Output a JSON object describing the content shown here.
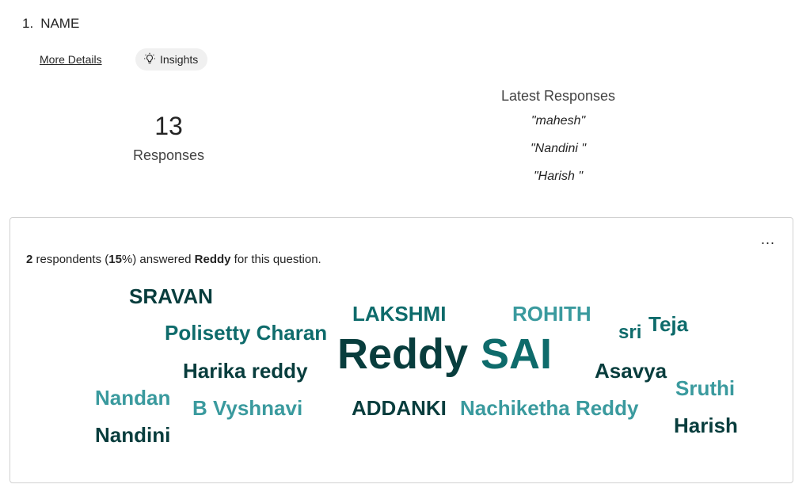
{
  "question": {
    "number": "1.",
    "title": "NAME"
  },
  "actions": {
    "more_details": "More Details",
    "insights": "Insights"
  },
  "stats": {
    "count": "13",
    "count_label": "Responses"
  },
  "latest": {
    "title": "Latest Responses",
    "items": [
      "\"mahesh\"",
      "\"Nandini \"",
      "\"Harish \""
    ]
  },
  "summary": {
    "count": "2",
    "text1": " respondents (",
    "percent": "15",
    "text2": "%) answered ",
    "answer": "Reddy",
    "text3": " for this question."
  },
  "menu": {
    "more_label": "..."
  },
  "colors": {
    "dark": "#083d3d",
    "mid": "#0e6b6b",
    "light": "#3a9a9e"
  },
  "word_cloud": [
    {
      "text": "SRAVAN",
      "tone": "dark"
    },
    {
      "text": "LAKSHMI",
      "tone": "mid"
    },
    {
      "text": "ROHITH",
      "tone": "light"
    },
    {
      "text": "Polisetty Charan",
      "tone": "mid"
    },
    {
      "text": "sri",
      "tone": "mid"
    },
    {
      "text": "Teja",
      "tone": "mid"
    },
    {
      "text": "Reddy",
      "tone": "dark"
    },
    {
      "text": "SAI",
      "tone": "mid"
    },
    {
      "text": "Harika reddy",
      "tone": "dark"
    },
    {
      "text": "Asavya",
      "tone": "dark"
    },
    {
      "text": "Sruthi",
      "tone": "light"
    },
    {
      "text": "Nandan",
      "tone": "light"
    },
    {
      "text": "B Vyshnavi",
      "tone": "light"
    },
    {
      "text": "ADDANKI",
      "tone": "dark"
    },
    {
      "text": "Nachiketha Reddy",
      "tone": "light"
    },
    {
      "text": "Harish",
      "tone": "dark"
    },
    {
      "text": "Nandini",
      "tone": "dark"
    }
  ]
}
